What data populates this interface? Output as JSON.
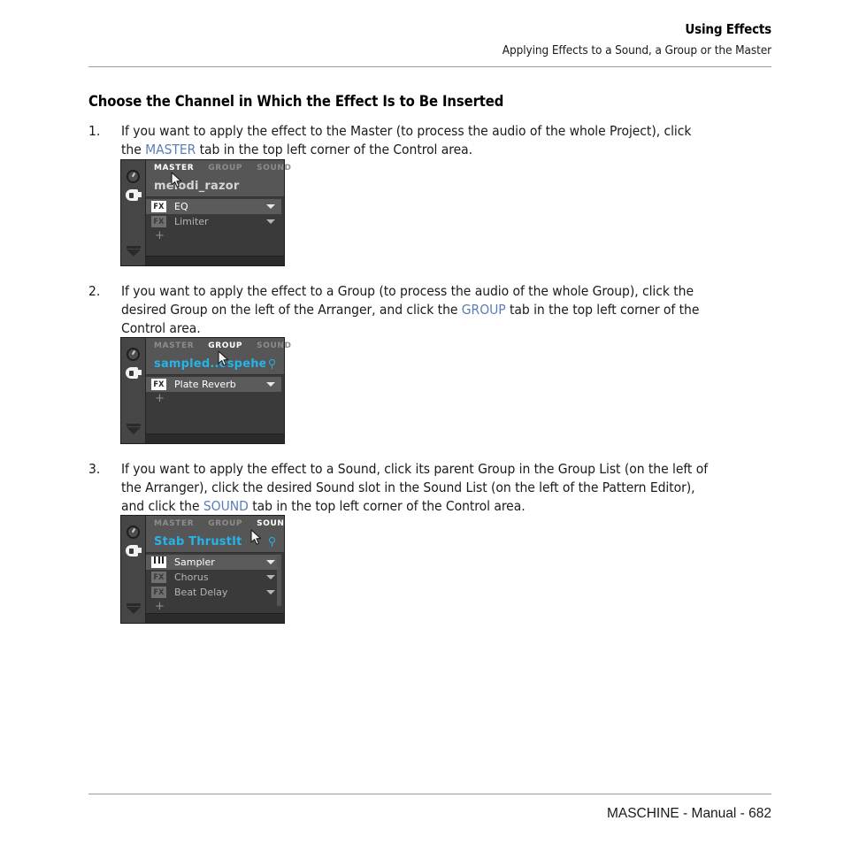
{
  "header": {
    "title": "Using Effects",
    "subtitle": "Applying Effects to a Sound, a Group or the Master"
  },
  "section_heading": "Choose the Channel in Which the Effect Is to Be Inserted",
  "steps": [
    {
      "number": "1.",
      "text_parts": [
        {
          "t": "If you want to apply the effect to the Master (to process the audio of the whole Project), click the ",
          "kw": false
        },
        {
          "t": "MASTER",
          "kw": true
        },
        {
          "t": " tab in the top left corner of the Control area.",
          "kw": false
        }
      ]
    },
    {
      "number": "2.",
      "text_parts": [
        {
          "t": "If you want to apply the effect to a Group (to process the audio of the whole Group), click the desired Group on the left of the Arranger, and click the ",
          "kw": false
        },
        {
          "t": "GROUP",
          "kw": true
        },
        {
          "t": " tab in the top left corner of the Control area.",
          "kw": false
        }
      ]
    },
    {
      "number": "3.",
      "text_parts": [
        {
          "t": "If you want to apply the effect to a Sound, click its parent Group in the Group List (on the left of the Arranger), click the desired Sound slot in the Sound List (on the left of the Pattern Editor), and click the ",
          "kw": false
        },
        {
          "t": "SOUND",
          "kw": true
        },
        {
          "t": " tab in the top left corner of the Control area.",
          "kw": false
        }
      ]
    }
  ],
  "panels": [
    {
      "id": "master-panel",
      "tabs": [
        {
          "label": "MASTER",
          "active": true
        },
        {
          "label": "GROUP",
          "active": false
        },
        {
          "label": "SOUND",
          "active": false
        }
      ],
      "channel_name": "melodi_razor",
      "channel_name_color": "#d5d5d5",
      "has_magnifier": false,
      "slots": [
        {
          "badge": "FX",
          "badge_type": "fx",
          "label": "EQ",
          "selected": true
        },
        {
          "badge": "FX",
          "badge_type": "fx",
          "label": "Limiter",
          "selected": false
        }
      ],
      "add_label": "+",
      "has_scrollbar": false
    },
    {
      "id": "group-panel",
      "tabs": [
        {
          "label": "MASTER",
          "active": false
        },
        {
          "label": "GROUP",
          "active": true
        },
        {
          "label": "SOUND",
          "active": false
        }
      ],
      "channel_name": "sampled..ospehere",
      "channel_name_color": "#26b3e8",
      "has_magnifier": true,
      "slots": [
        {
          "badge": "FX",
          "badge_type": "fx",
          "label": "Plate Reverb",
          "selected": true
        }
      ],
      "add_label": "+",
      "has_scrollbar": false
    },
    {
      "id": "sound-panel",
      "tabs": [
        {
          "label": "MASTER",
          "active": false
        },
        {
          "label": "GROUP",
          "active": false
        },
        {
          "label": "SOUND",
          "active": true
        }
      ],
      "channel_name": "Stab ThrustIt",
      "channel_name_color": "#26b3e8",
      "has_magnifier": true,
      "slots": [
        {
          "badge": "keyboard-icon",
          "badge_type": "keys",
          "label": "Sampler",
          "selected": true
        },
        {
          "badge": "FX",
          "badge_type": "fx",
          "label": "Chorus",
          "selected": false
        },
        {
          "badge": "FX",
          "badge_type": "fx",
          "label": "Beat Delay",
          "selected": false
        }
      ],
      "add_label": "+",
      "has_scrollbar": true
    }
  ],
  "footer": {
    "text": "MASCHINE - Manual - 682"
  },
  "colors": {
    "link": "#5b7fb5",
    "panel_blue": "#26b3e8",
    "rule": "#9a9a9a"
  }
}
